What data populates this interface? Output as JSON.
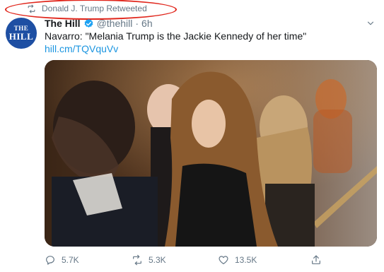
{
  "retweet_context": {
    "text": "Donald J. Trump Retweeted",
    "icon": "retweet-icon"
  },
  "author": {
    "display_name": "The Hill",
    "handle": "@thehill",
    "separator": "·",
    "timestamp": "6h",
    "verified": true,
    "avatar_text": {
      "line1": "THE",
      "line2": "HILL"
    }
  },
  "tweet": {
    "text": "Navarro: \"Melania Trump is the Jackie Kennedy of her time\"",
    "link": "hill.cm/TQVquVv"
  },
  "actions": {
    "replies": "5.7K",
    "retweets": "5.3K",
    "likes": "13.5K"
  },
  "colors": {
    "link": "#1b95e0",
    "secondary_text": "#657786",
    "annotation": "#e0261c",
    "avatar_bg": "#1e4fa3"
  }
}
